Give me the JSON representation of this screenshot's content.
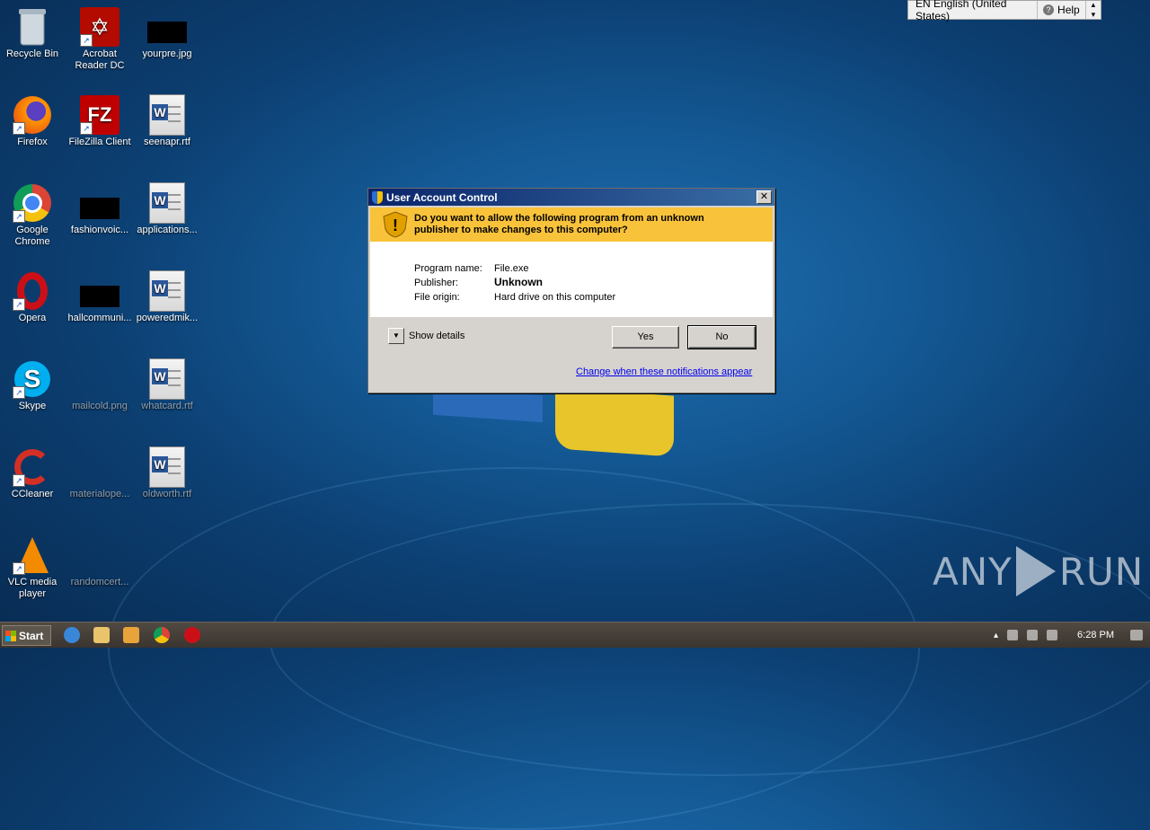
{
  "desktop": {
    "icons": [
      {
        "label": "Recycle Bin"
      },
      {
        "label": "Acrobat Reader DC"
      },
      {
        "label": "yourpre.jpg"
      },
      {
        "label": "Firefox"
      },
      {
        "label": "FileZilla Client"
      },
      {
        "label": "seenapr.rtf"
      },
      {
        "label": "Google Chrome"
      },
      {
        "label": "fashionvoic..."
      },
      {
        "label": "applications..."
      },
      {
        "label": "Opera"
      },
      {
        "label": "hallcommuni..."
      },
      {
        "label": "poweredmik..."
      },
      {
        "label": "Skype"
      },
      {
        "label": "mailcold.png"
      },
      {
        "label": "whatcard.rtf"
      },
      {
        "label": "CCleaner"
      },
      {
        "label": "materialope..."
      },
      {
        "label": "oldworth.rtf"
      },
      {
        "label": "VLC media player"
      },
      {
        "label": "randomcert..."
      }
    ]
  },
  "langbar": {
    "language": "EN English (United States)",
    "help": "Help"
  },
  "uac": {
    "title": "User Account Control",
    "question": "Do you want to allow the following program from an unknown publisher to make changes to this computer?",
    "program_name_label": "Program name:",
    "program_name": "File.exe",
    "publisher_label": "Publisher:",
    "publisher": "Unknown",
    "file_origin_label": "File origin:",
    "file_origin": "Hard drive on this computer",
    "show_details": "Show details",
    "yes": "Yes",
    "no": "No",
    "link": "Change when these notifications appear"
  },
  "watermark": {
    "left": "ANY",
    "right": "RUN"
  },
  "taskbar": {
    "start": "Start",
    "clock": "6:28 PM"
  }
}
